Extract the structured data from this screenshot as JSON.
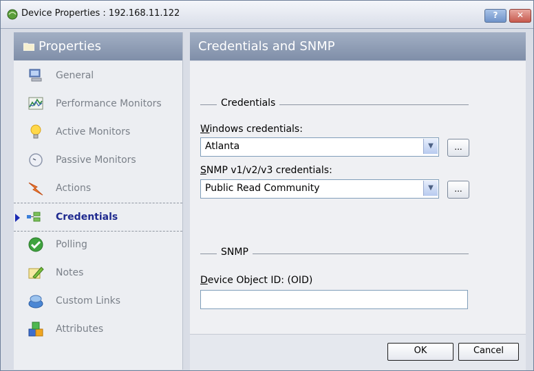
{
  "window": {
    "title": "Device Properties : 192.168.11.122",
    "help_label": "?",
    "close_label": "✕"
  },
  "sidebar": {
    "title": "Properties",
    "items": [
      {
        "label": "General",
        "icon": "computer-icon"
      },
      {
        "label": "Performance Monitors",
        "icon": "chart-icon"
      },
      {
        "label": "Active Monitors",
        "icon": "lightbulb-icon"
      },
      {
        "label": "Passive Monitors",
        "icon": "gauge-icon"
      },
      {
        "label": "Actions",
        "icon": "lightning-icon"
      },
      {
        "label": "Credentials",
        "icon": "credentials-icon",
        "active": true
      },
      {
        "label": "Polling",
        "icon": "check-icon"
      },
      {
        "label": "Notes",
        "icon": "pencil-icon"
      },
      {
        "label": "Custom Links",
        "icon": "links-icon"
      },
      {
        "label": "Attributes",
        "icon": "blocks-icon"
      }
    ]
  },
  "panel": {
    "title": "Credentials and SNMP",
    "credentials_group": "Credentials",
    "windows_label_hotkey": "W",
    "windows_label_rest": "indows credentials:",
    "windows_value": "Atlanta",
    "snmp_label_hotkey": "S",
    "snmp_label_rest": "NMP v1/v2/v3 credentials:",
    "snmp_value": "Public Read Community",
    "ellipsis": "...",
    "snmp_group": "SNMP",
    "oid_label_hotkey": "D",
    "oid_label_rest": "evice Object ID: (OID)",
    "oid_value": ""
  },
  "footer": {
    "ok": "OK",
    "cancel": "Cancel"
  },
  "colors": {
    "accent": "#1b2bb3",
    "header_bg": "#8e9cb6",
    "active_label": "#1f2a8f"
  }
}
